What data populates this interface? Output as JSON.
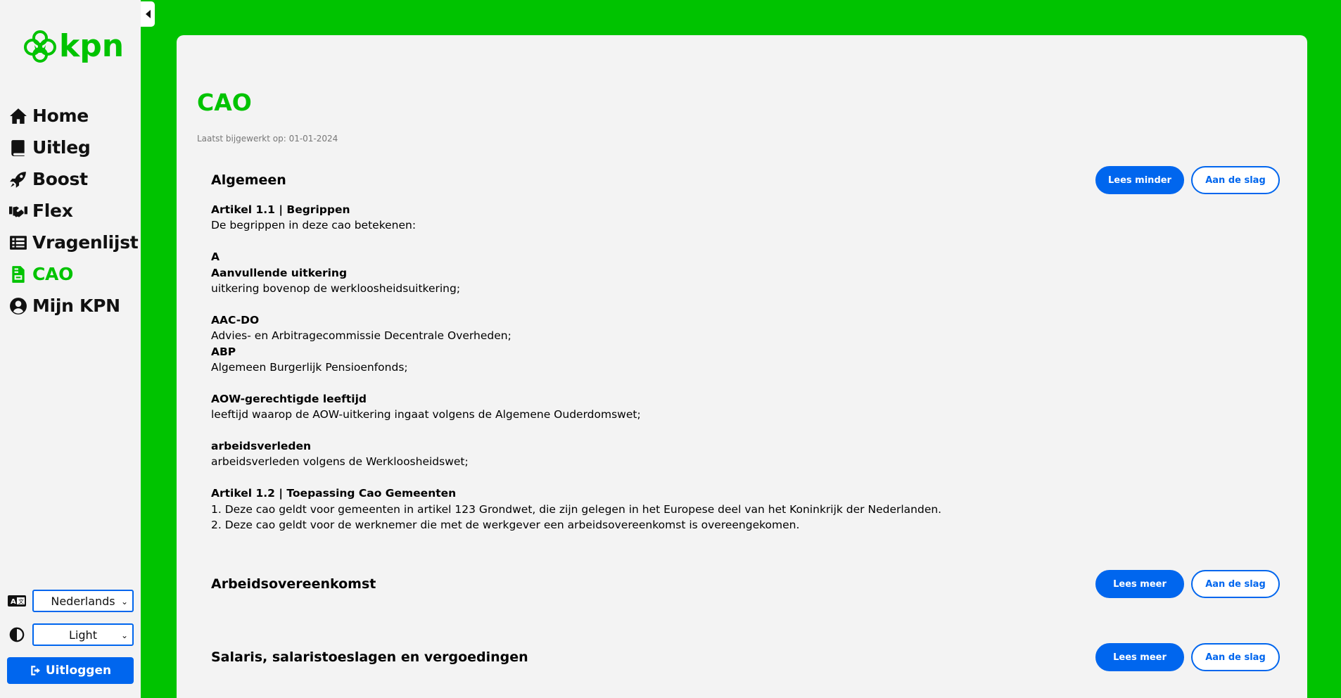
{
  "brand": {
    "logo_text": "kpn",
    "color": "#00c300",
    "accent": "#0066ee"
  },
  "nav": [
    {
      "label": "Home",
      "icon": "home-icon"
    },
    {
      "label": "Uitleg",
      "icon": "book-icon"
    },
    {
      "label": "Boost",
      "icon": "rocket-icon"
    },
    {
      "label": "Flex",
      "icon": "handshake-icon"
    },
    {
      "label": "Vragenlijst",
      "icon": "list-icon"
    },
    {
      "label": "CAO",
      "icon": "file-contract-icon",
      "active": true
    },
    {
      "label": "Mijn KPN",
      "icon": "user-circle-icon"
    }
  ],
  "settings": {
    "language": "Nederlands",
    "theme": "Light",
    "logout_label": "Uitloggen"
  },
  "page": {
    "title": "CAO",
    "updated": "Laatst bijgewerkt op: 01-01-2024"
  },
  "sections": [
    {
      "title": "Algemeen",
      "primary_label": "Lees minder",
      "secondary_label": "Aan de slag",
      "expanded": true
    },
    {
      "title": "Arbeidsovereenkomst",
      "primary_label": "Lees meer",
      "secondary_label": "Aan de slag"
    },
    {
      "title": "Salaris, salaristoeslagen en vergoedingen",
      "primary_label": "Lees meer",
      "secondary_label": "Aan de slag"
    }
  ],
  "algemeen_content": {
    "art1_title": "Artikel 1.1 | Begrippen",
    "art1_intro": "De begrippen in deze cao betekenen:",
    "letter": "A",
    "t1": "Aanvullende uitkering",
    "d1": "uitkering bovenop de werkloosheidsuitkering;",
    "t2": "AAC-DO",
    "d2": "Advies- en Arbitragecommissie Decentrale Overheden;",
    "t3": "ABP",
    "d3": "Algemeen Burgerlijk Pensioenfonds;",
    "t4": "AOW-gerechtigde leeftijd",
    "d4": "leeftijd waarop de AOW-uitkering ingaat volgens de Algemene Ouderdomswet;",
    "t5": "arbeidsverleden",
    "d5": "arbeidsverleden volgens de Werkloosheidswet;",
    "art2_title": "Artikel 1.2 | Toepassing Cao Gemeenten",
    "art2_p1": "1. Deze cao geldt voor gemeenten in artikel 123 Grondwet, die zijn gelegen in het Europese deel van het Koninkrijk der Nederlanden.",
    "art2_p2": "2. Deze cao geldt voor de werknemer die met de werkgever een arbeidsovereenkomst is overeengekomen."
  }
}
